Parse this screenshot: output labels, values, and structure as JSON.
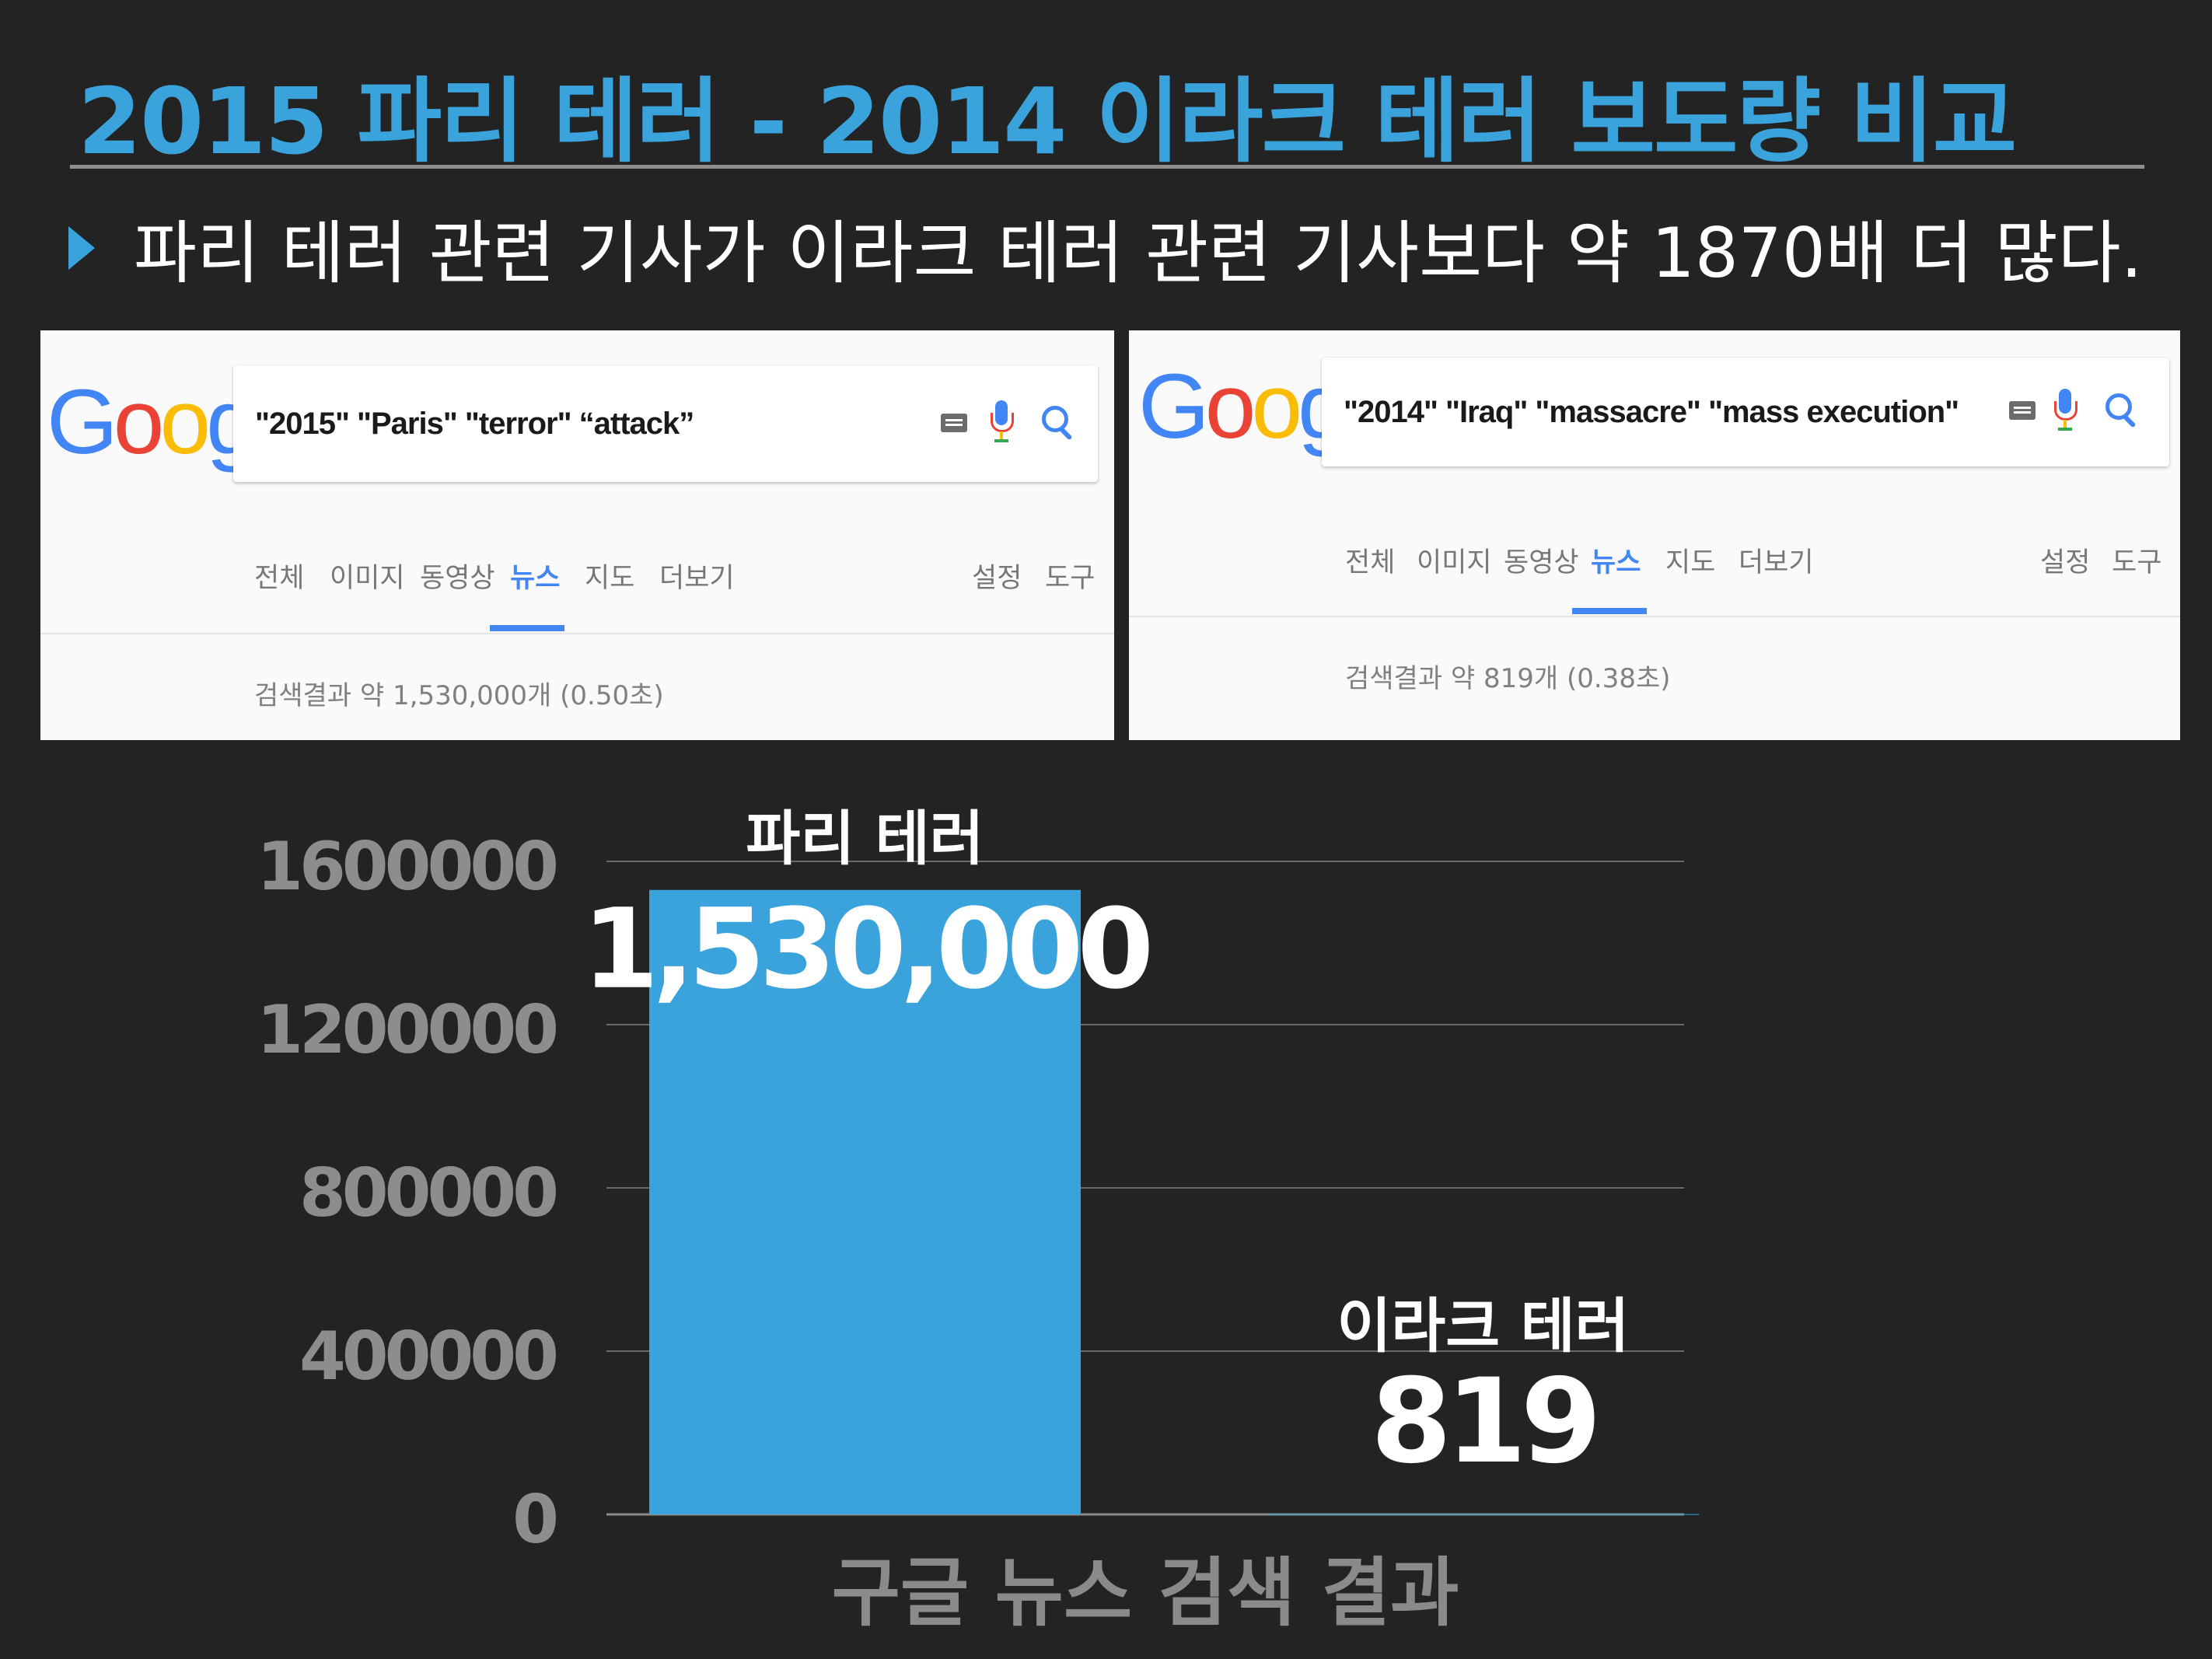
{
  "slide": {
    "title": "2015 파리 테러 - 2014 이라크 테러 보도량 비교",
    "bullet": "파리 테러 관련 기사가 이라크 테러 관련 기사보다 약 1870배 더 많다."
  },
  "colors": {
    "accent": "#3aa3dc",
    "background": "#232323",
    "google_blue": "#4285f4"
  },
  "screenshots": [
    {
      "logo": "Google",
      "query": "\"2015\" \"Paris\" \"terror\" “attack”",
      "icons": [
        "keyboard-icon",
        "mic-icon",
        "search-icon"
      ],
      "tabs": [
        "전체",
        "이미지",
        "동영상",
        "뉴스",
        "지도",
        "더보기"
      ],
      "active_tab": "뉴스",
      "tools": [
        "설정",
        "도구"
      ],
      "results": "검색결과 약 1,530,000개 (0.50초)"
    },
    {
      "logo": "Google",
      "query": "\"2014\" \"Iraq\" \"massacre\" \"mass execution\"",
      "icons": [
        "keyboard-icon",
        "mic-icon",
        "search-icon"
      ],
      "tabs": [
        "전체",
        "이미지",
        "동영상",
        "뉴스",
        "지도",
        "더보기"
      ],
      "active_tab": "뉴스",
      "tools": [
        "설정",
        "도구"
      ],
      "results": "검색결과 약 819개 (0.38초)"
    }
  ],
  "chart_data": {
    "type": "bar",
    "categories": [
      "파리 테러",
      "이라크 테러"
    ],
    "values": [
      1530000,
      819
    ],
    "value_labels": [
      "1,530,000",
      "819"
    ],
    "xlabel": "구글 뉴스 검색 결과",
    "ylabel": "",
    "ylim": [
      0,
      1600000
    ],
    "yticks": [
      "1600000",
      "1200000",
      "800000",
      "400000",
      "0"
    ],
    "grid": true,
    "bar_color": "#3aa3dc"
  }
}
